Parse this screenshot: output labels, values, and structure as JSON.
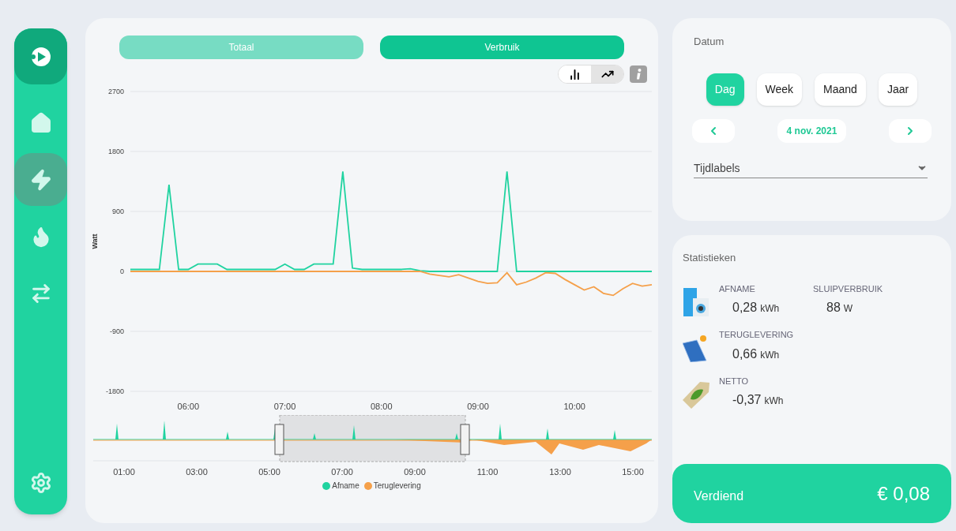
{
  "sidebar": {
    "items": [
      {
        "kind": "home",
        "selected": false
      },
      {
        "kind": "power",
        "selected": true
      },
      {
        "kind": "gas",
        "selected": false
      },
      {
        "kind": "exchange",
        "selected": false
      }
    ]
  },
  "main": {
    "tabs": [
      {
        "label": "Totaal",
        "selected": false
      },
      {
        "label": "Verbruik",
        "selected": true
      }
    ],
    "chart_types": [
      {
        "kind": "bar",
        "selected": false
      },
      {
        "kind": "line",
        "selected": true
      }
    ],
    "chart_data": {
      "type": "line",
      "ylabel": "Watt",
      "x": [
        5.4,
        5.5,
        5.6,
        5.7,
        5.8,
        5.9,
        6.0,
        6.1,
        6.2,
        6.3,
        6.4,
        6.5,
        6.6,
        6.7,
        6.8,
        6.9,
        7.0,
        7.1,
        7.2,
        7.3,
        7.4,
        7.5,
        7.6,
        7.7,
        7.8,
        7.9,
        8.0,
        8.1,
        8.2,
        8.3,
        8.4,
        8.5,
        8.6,
        8.7,
        8.8,
        8.9,
        9.0,
        9.1,
        9.2,
        9.3,
        9.4,
        9.5,
        9.6,
        9.7,
        9.8,
        9.9,
        10.0,
        10.1,
        10.2,
        10.3,
        10.4,
        10.5,
        10.6,
        10.7,
        10.8
      ],
      "series": [
        {
          "name": "Afname",
          "color": "#20d3a0",
          "values": [
            30,
            30,
            30,
            30,
            1300,
            30,
            30,
            110,
            110,
            110,
            30,
            30,
            30,
            30,
            30,
            30,
            110,
            30,
            30,
            110,
            110,
            110,
            1500,
            50,
            30,
            30,
            30,
            30,
            30,
            40,
            10,
            0,
            0,
            0,
            0,
            0,
            0,
            0,
            0,
            1500,
            0,
            0,
            0,
            0,
            0,
            0,
            0,
            0,
            0,
            0,
            0,
            0,
            0,
            0,
            0
          ]
        },
        {
          "name": "Teruglevering",
          "color": "#f5a04a",
          "values": [
            0,
            0,
            0,
            0,
            0,
            0,
            0,
            0,
            0,
            0,
            0,
            0,
            0,
            0,
            0,
            0,
            0,
            0,
            0,
            0,
            0,
            0,
            0,
            0,
            0,
            0,
            0,
            0,
            0,
            0,
            0,
            -40,
            -60,
            -80,
            -50,
            -100,
            -150,
            -180,
            -170,
            -20,
            -200,
            -160,
            -100,
            -20,
            -30,
            -120,
            -200,
            -280,
            -230,
            -330,
            -360,
            -260,
            -180,
            -220,
            -200
          ]
        }
      ],
      "grid": true,
      "xlim": [
        5.4,
        10.8
      ],
      "ylim": [
        -1800,
        2700
      ],
      "yticks": [
        2700,
        1800,
        900,
        0,
        -900,
        -1800
      ],
      "xticks": [
        {
          "value": 6,
          "label": "06:00"
        },
        {
          "value": 7,
          "label": "07:00"
        },
        {
          "value": 8,
          "label": "08:00"
        },
        {
          "value": 9,
          "label": "09:00"
        },
        {
          "value": 10,
          "label": "10:00"
        }
      ]
    },
    "navigator_labels": [
      "01:00",
      "03:00",
      "05:00",
      "07:00",
      "09:00",
      "11:00",
      "13:00",
      "15:00"
    ]
  },
  "date_card": {
    "title": "Datum",
    "ranges": [
      {
        "label": "Dag",
        "selected": true
      },
      {
        "label": "Week",
        "selected": false
      },
      {
        "label": "Maand",
        "selected": false
      },
      {
        "label": "Jaar",
        "selected": false
      }
    ],
    "date": "4 nov. 2021",
    "select": {
      "value": "Tijdlabels"
    }
  },
  "stats_card": {
    "title": "Statistieken",
    "rows": [
      {
        "kind": "appliance",
        "items": [
          {
            "label": "AFNAME",
            "value": "0,28",
            "unit": "kWh"
          },
          {
            "label": "SLUIPVERBRUIK",
            "value": "88",
            "unit": "W"
          }
        ]
      },
      {
        "kind": "solar",
        "items": [
          {
            "label": "TERUGLEVERING",
            "value": "0,66",
            "unit": "kWh"
          }
        ]
      },
      {
        "kind": "tag",
        "items": [
          {
            "label": "NETTO",
            "value": "-0,37",
            "unit": "kWh"
          }
        ]
      }
    ],
    "footer": {
      "label": "Verdiend",
      "amount": "€ 0,08"
    }
  }
}
